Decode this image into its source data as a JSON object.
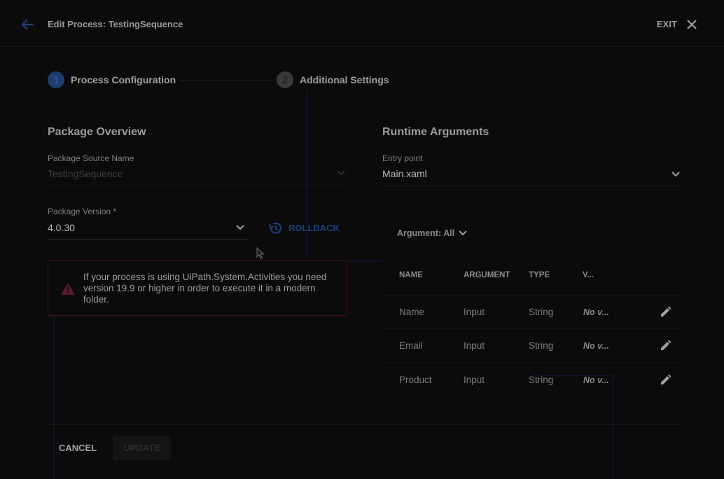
{
  "header": {
    "title": "Edit Process: TestingSequence",
    "exit_label": "EXIT"
  },
  "steps": [
    {
      "number": "1",
      "label": "Process Configuration"
    },
    {
      "number": "2",
      "label": "Additional Settings"
    }
  ],
  "package_overview": {
    "heading": "Package Overview",
    "source_label": "Package Source Name",
    "source_value": "TestingSequence",
    "version_label": "Package Version *",
    "version_value": "4.0.30",
    "rollback_label": "ROLLBACK",
    "alert_text": "If your process is using UiPath.System.Activities you need version 19.9 or higher in order to execute it in a modern folder."
  },
  "runtime_arguments": {
    "heading": "Runtime Arguments",
    "entry_point_label": "Entry point",
    "entry_point_value": "Main.xaml",
    "filter_label": "Argument: All",
    "columns": [
      "NAME",
      "ARGUMENT",
      "TYPE",
      "V..."
    ],
    "rows": [
      {
        "name": "Name",
        "argument": "Input",
        "type": "String",
        "value": "No v..."
      },
      {
        "name": "Email",
        "argument": "Input",
        "type": "String",
        "value": "No v..."
      },
      {
        "name": "Product",
        "argument": "Input",
        "type": "String",
        "value": "No v..."
      }
    ]
  },
  "footer": {
    "cancel_label": "CANCEL",
    "update_label": "UPDATE"
  },
  "colors": {
    "accent": "#1c3d6e",
    "alert_border": "#4a1221",
    "alert_icon": "#5a1a2c",
    "background": "#0b0b0c"
  }
}
